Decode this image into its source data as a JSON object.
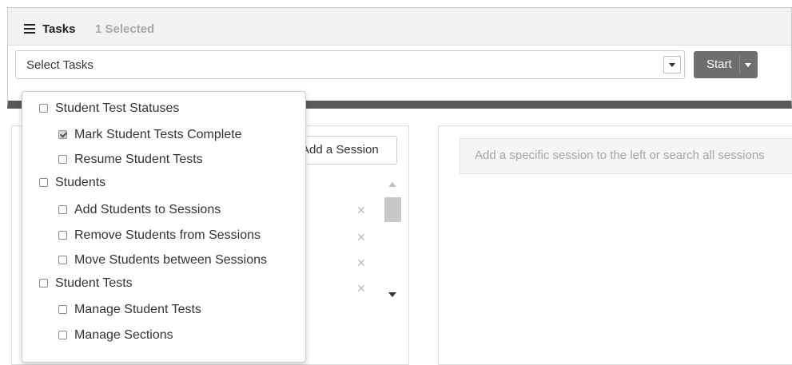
{
  "tasks": {
    "title": "Tasks",
    "selected_count": "1 Selected",
    "select_placeholder": "Select Tasks",
    "start_label": "Start"
  },
  "sessions": {
    "add_session_label": "Add a Session",
    "right_hint": "Add a specific session to the left or search all sessions"
  },
  "dropdown": {
    "options": [
      {
        "label": "Student Test Statuses",
        "level": 0,
        "checked": false
      },
      {
        "label": "Mark Student Tests Complete",
        "level": 1,
        "checked": true
      },
      {
        "label": "Resume Student Tests",
        "level": 1,
        "checked": false
      },
      {
        "label": "Students",
        "level": 0,
        "checked": false
      },
      {
        "label": "Add Students to Sessions",
        "level": 1,
        "checked": false
      },
      {
        "label": "Remove Students from Sessions",
        "level": 1,
        "checked": false
      },
      {
        "label": "Move Students between Sessions",
        "level": 1,
        "checked": false
      },
      {
        "label": "Student Tests",
        "level": 0,
        "checked": false
      },
      {
        "label": "Manage Student Tests",
        "level": 1,
        "checked": false
      },
      {
        "label": "Manage Sections",
        "level": 1,
        "checked": false
      }
    ]
  },
  "icons": {
    "tasks": "list-icon",
    "caret": "chevron-down-icon",
    "remove": "close-icon"
  },
  "colors": {
    "start_button": "#6e6e6e",
    "panel_border": "#5a5a5a",
    "muted_text": "#a8a8a8"
  }
}
